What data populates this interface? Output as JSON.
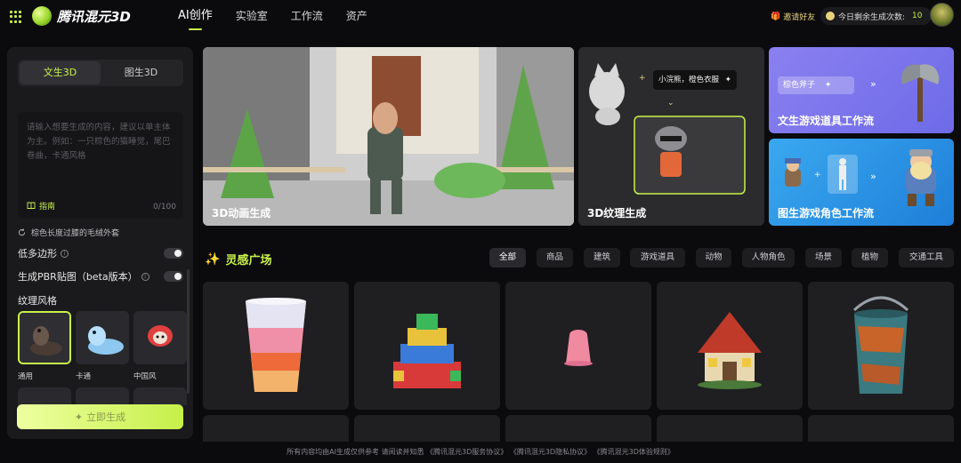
{
  "header": {
    "logo_text": "腾讯混元3D",
    "nav": [
      "AI创作",
      "实验室",
      "工作流",
      "资产"
    ],
    "invite": "邀请好友",
    "quota_label": "今日剩余生成次数:",
    "quota_value": "10"
  },
  "left": {
    "tabs": [
      "文生3D",
      "图生3D"
    ],
    "prompt_placeholder": "请输入想要生成的内容，建议以单主体为主。例如：一只棕色的猫睡觉，尾巴卷曲，卡通风格",
    "guide": "指南",
    "count": "0/100",
    "suggestion": "棕色长度过膝的毛绒外套",
    "options": [
      {
        "label": "低多边形"
      },
      {
        "label": "生成PBR贴图（beta版本）"
      }
    ],
    "texture_title": "纹理风格",
    "styles": [
      "通用",
      "卡通",
      "中国风"
    ],
    "generate": "立即生成"
  },
  "banners": {
    "anim": "3D动画生成",
    "texture": "3D纹理生成",
    "texture_prompt": "小浣熊，橙色衣服",
    "prop_prompt": "棕色斧子",
    "prop": "文生游戏道具工作流",
    "char": "图生游戏角色工作流"
  },
  "gallery": {
    "title": "灵感广场",
    "filters": [
      "全部",
      "商品",
      "建筑",
      "游戏道具",
      "动物",
      "人物角色",
      "场景",
      "植物",
      "交通工具"
    ]
  },
  "footer": "所有内容均由AI生成仅供参考 请阅读并知悉 《腾讯混元3D服务协议》 《腾讯混元3D隐私协议》 《腾讯混元3D体验规则》",
  "colors": {
    "accent": "#c9f24a",
    "bg": "#0b0b0d",
    "panel": "#1a1a1c"
  }
}
